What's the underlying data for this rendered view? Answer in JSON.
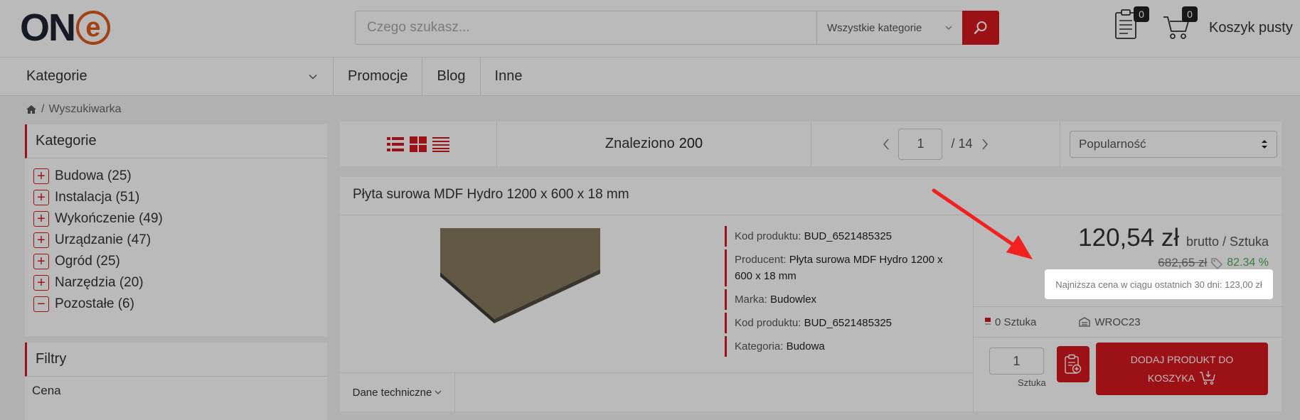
{
  "header": {
    "logo_text": "ON",
    "logo_e": "e",
    "search_placeholder": "Czego szukasz...",
    "search_category": "Wszystkie kategorie",
    "compare_count": "0",
    "cart_count": "0",
    "cart_label": "Koszyk pusty"
  },
  "nav": {
    "categories_label": "Kategorie",
    "items": [
      "Promocje",
      "Blog",
      "Inne"
    ]
  },
  "breadcrumb": {
    "current": "Wyszukiwarka"
  },
  "sidebar": {
    "categories_title": "Kategorie",
    "categories": [
      {
        "label": "Budowa (25)",
        "sign": "+"
      },
      {
        "label": "Instalacja (51)",
        "sign": "+"
      },
      {
        "label": "Wykończenie (49)",
        "sign": "+"
      },
      {
        "label": "Urządzanie (47)",
        "sign": "+"
      },
      {
        "label": "Ogród (25)",
        "sign": "+"
      },
      {
        "label": "Narzędzia (20)",
        "sign": "+"
      },
      {
        "label": "Pozostałe (6)",
        "sign": "−"
      }
    ],
    "filters_title": "Filtry",
    "filter_price": "Cena"
  },
  "toolbar": {
    "found_label": "Znaleziono",
    "found_count": "200",
    "page": "1",
    "total_pages": "/ 14",
    "sort": "Popularność"
  },
  "product": {
    "title": "Płyta surowa MDF Hydro 1200 x 600 x 18 mm",
    "specs": [
      {
        "label": "Kod produktu:",
        "value": "BUD_6521485325"
      },
      {
        "label": "Producent:",
        "value": "Płyta surowa MDF Hydro 1200 x 600 x 18 mm"
      },
      {
        "label": "Marka:",
        "value": "Budowlex"
      },
      {
        "label": "Kod produktu:",
        "value": "BUD_6521485325"
      },
      {
        "label": "Kategoria:",
        "value": "Budowa"
      }
    ],
    "price": "120,54 zł",
    "price_unit": "brutto / Sztuka",
    "old_price": "682,65 zł",
    "discount": "82.34 %",
    "lowest_price_note": "Najniższa cena w ciągu ostatnich 30 dni: 123,00 zł",
    "stock": "0 Sztuka",
    "warehouse": "WROC23",
    "quantity": "1",
    "quantity_unit": "Sztuka",
    "add_to_cart_line1": "DODAJ PRODUKT DO",
    "add_to_cart_line2": "KOSZYKA",
    "tech_tab": "Dane techniczne"
  },
  "colors": {
    "accent": "#d6181f",
    "logo_dark": "#1d2432",
    "logo_orange": "#e05a1a",
    "discount_green": "#4caf50"
  }
}
